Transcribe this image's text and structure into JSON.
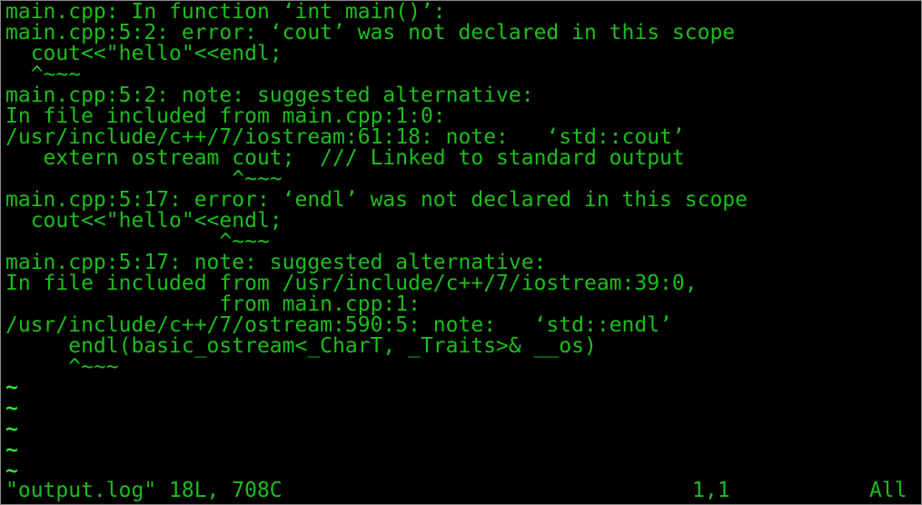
{
  "buffer": {
    "lines": [
      "main.cpp: In function ‘int main()’:",
      "main.cpp:5:2: error: ‘cout’ was not declared in this scope",
      "  cout<<\"hello\"<<endl;",
      "  ^~~~",
      "main.cpp:5:2: note: suggested alternative:",
      "In file included from main.cpp:1:0:",
      "/usr/include/c++/7/iostream:61:18: note:   ‘std::cout’",
      "   extern ostream cout;  /// Linked to standard output",
      "                  ^~~~",
      "main.cpp:5:17: error: ‘endl’ was not declared in this scope",
      "  cout<<\"hello\"<<endl;",
      "                 ^~~~",
      "main.cpp:5:17: note: suggested alternative:",
      "In file included from /usr/include/c++/7/iostream:39:0,",
      "                 from main.cpp:1:",
      "/usr/include/c++/7/ostream:590:5: note:   ‘std::endl’",
      "     endl(basic_ostream<_CharT, _Traits>& __os)",
      "     ^~~~"
    ],
    "empty_markers": [
      "~",
      "~",
      "~",
      "~",
      "~"
    ]
  },
  "statusbar": {
    "file_info": "\"output.log\" 18L, 708C",
    "cursor_position": "1,1",
    "scroll_position": "All"
  },
  "colors": {
    "background": "#000000",
    "text": "#1dbd1d",
    "tilde": "#31e431",
    "border": "#8a8a8a"
  }
}
